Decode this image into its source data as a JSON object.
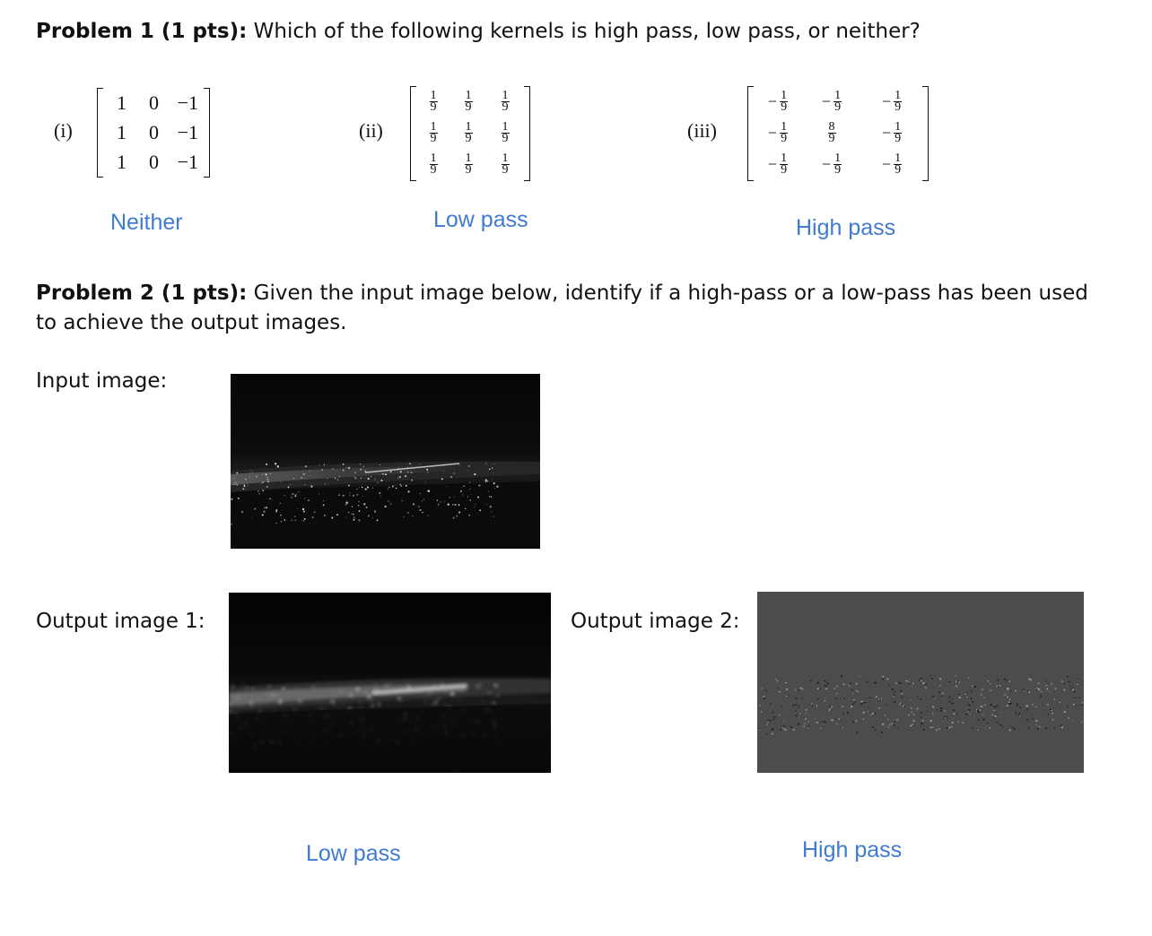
{
  "problem1": {
    "heading": "Problem 1 (1 pts):",
    "question": "Which of the following kernels is high pass, low pass, or neither?",
    "kernels": [
      {
        "label": "(i)",
        "rows": [
          [
            "1",
            "0",
            "−1"
          ],
          [
            "1",
            "0",
            "−1"
          ],
          [
            "1",
            "0",
            "−1"
          ]
        ],
        "answer": "Neither"
      },
      {
        "label": "(ii)",
        "rows": [
          [
            "1/9",
            "1/9",
            "1/9"
          ],
          [
            "1/9",
            "1/9",
            "1/9"
          ],
          [
            "1/9",
            "1/9",
            "1/9"
          ]
        ],
        "answer": "Low pass"
      },
      {
        "label": "(iii)",
        "rows": [
          [
            "−1/9",
            "−1/9",
            "−1/9"
          ],
          [
            "−1/9",
            "8/9",
            "−1/9"
          ],
          [
            "−1/9",
            "−1/9",
            "−1/9"
          ]
        ],
        "answer": "High pass"
      }
    ]
  },
  "problem2": {
    "heading": "Problem 2 (1 pts):",
    "question": "Given the input image below, identify if a high-pass or a low-pass has been used to achieve the output images.",
    "input_label": "Input image:",
    "output1_label": "Output image 1:",
    "output2_label": "Output image 2:",
    "answer1": "Low pass",
    "answer2": "High pass"
  }
}
